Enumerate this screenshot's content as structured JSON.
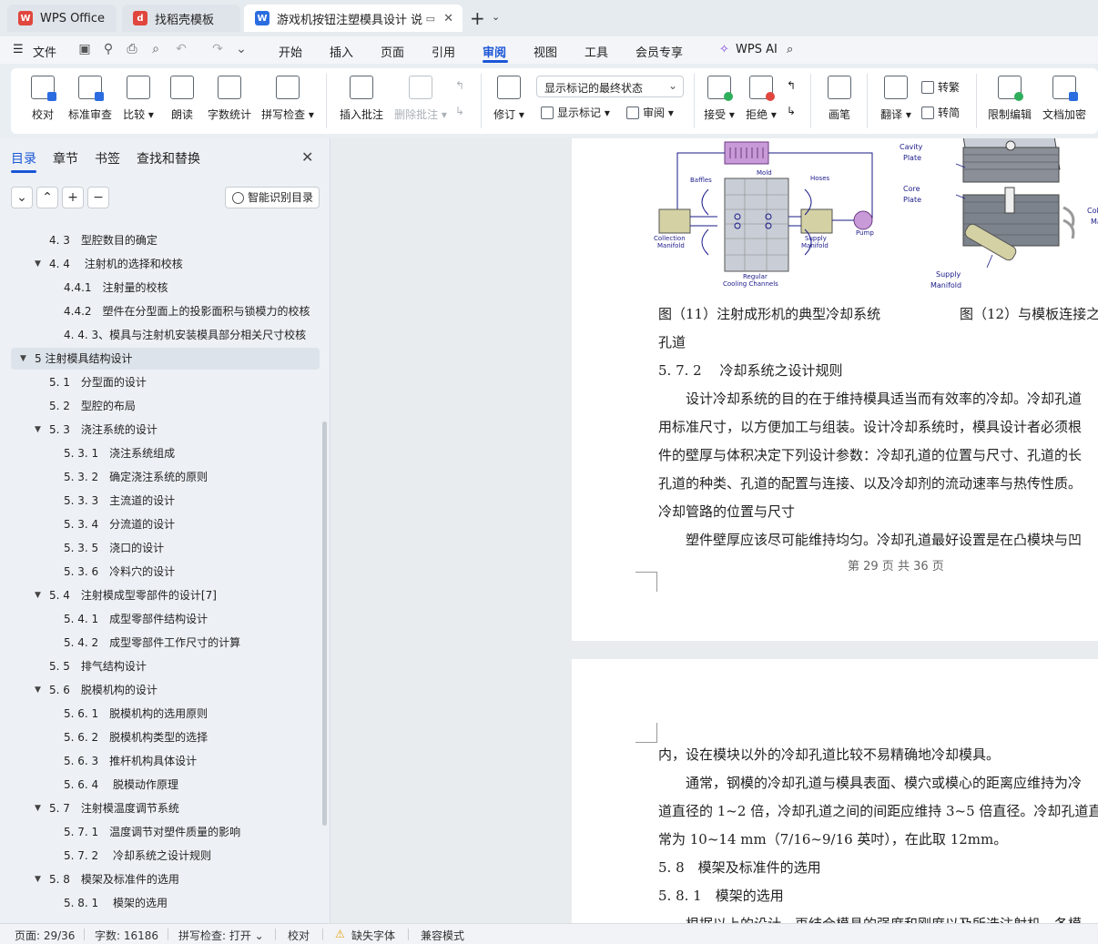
{
  "tabs": [
    {
      "label": "WPS Office",
      "icon": "wps-logo-icon"
    },
    {
      "label": "找稻壳模板",
      "icon": "docer-icon"
    },
    {
      "label": "游戏机按钮注塑模具设计 说明",
      "icon": "writer-doc-icon"
    }
  ],
  "menu": {
    "file": "文件",
    "items": [
      "开始",
      "插入",
      "页面",
      "引用",
      "审阅",
      "视图",
      "工具",
      "会员专享"
    ],
    "active": "审阅",
    "wps_ai": "WPS AI"
  },
  "ribbon": {
    "proofread": "校对",
    "standard_review": "标准审查",
    "compare": "比较",
    "read_aloud": "朗读",
    "word_count": "字数统计",
    "spell_check": "拼写检查",
    "insert_comment": "插入批注",
    "delete_comment": "删除批注",
    "track_changes": "修订",
    "markup_mode": "显示标记的最终状态",
    "show_markup": "显示标记",
    "reviewing": "审阅",
    "accept": "接受",
    "reject": "拒绝",
    "ink": "画笔",
    "translate": "翻译",
    "to_traditional": "转繁",
    "to_simplified": "转简",
    "restrict_editing": "限制编辑",
    "encrypt": "文档加密"
  },
  "sidebar": {
    "tabs": [
      "目录",
      "章节",
      "书签",
      "查找和替换"
    ],
    "smart_toc": "智能识别目录",
    "toc": [
      {
        "text": "4. 3　型腔数目的确定",
        "level": 2
      },
      {
        "text": "4. 4　 注射机的选择和校核",
        "level": 2,
        "expanded": true
      },
      {
        "text": "4.4.1　注射量的校核",
        "level": 3
      },
      {
        "text": "4.4.2　塑件在分型面上的投影面积与锁模力的校核",
        "level": 3
      },
      {
        "text": "4. 4. 3、模具与注射机安装模具部分相关尺寸校核",
        "level": 3
      },
      {
        "text": "5  注射模具结构设计",
        "level": 1,
        "expanded": true,
        "selected": true
      },
      {
        "text": "5. 1　分型面的设计",
        "level": 2
      },
      {
        "text": "5. 2　型腔的布局",
        "level": 2
      },
      {
        "text": "5. 3　浇注系统的设计",
        "level": 2,
        "expanded": true
      },
      {
        "text": "5. 3. 1　浇注系统组成",
        "level": 3
      },
      {
        "text": "5. 3. 2　确定浇注系统的原则",
        "level": 3
      },
      {
        "text": "5. 3. 3　主流道的设计",
        "level": 3
      },
      {
        "text": "5. 3. 4　分流道的设计",
        "level": 3
      },
      {
        "text": "5. 3. 5　浇口的设计",
        "level": 3
      },
      {
        "text": "5. 3. 6　冷料穴的设计",
        "level": 3
      },
      {
        "text": "5. 4　注射模成型零部件的设计[7]",
        "level": 2,
        "expanded": true
      },
      {
        "text": "5. 4. 1　成型零部件结构设计",
        "level": 3
      },
      {
        "text": "5. 4. 2　成型零部件工作尺寸的计算",
        "level": 3
      },
      {
        "text": "5. 5　排气结构设计",
        "level": 2
      },
      {
        "text": "5. 6　脱模机构的设计",
        "level": 2,
        "expanded": true
      },
      {
        "text": "5. 6. 1　脱模机构的选用原则",
        "level": 3
      },
      {
        "text": "5. 6. 2　脱模机构类型的选择",
        "level": 3
      },
      {
        "text": "5. 6. 3　推杆机构具体设计",
        "level": 3
      },
      {
        "text": "5. 6. 4　 脱模动作原理",
        "level": 3
      },
      {
        "text": "5. 7　注射模温度调节系统",
        "level": 2,
        "expanded": true
      },
      {
        "text": "5. 7. 1　温度调节对塑件质量的影响",
        "level": 3
      },
      {
        "text": "5. 7. 2　 冷却系统之设计规则",
        "level": 3
      },
      {
        "text": "5. 8　模架及标准件的选用",
        "level": 2,
        "expanded": true
      },
      {
        "text": "5. 8. 1　 模架的选用",
        "level": 3
      }
    ]
  },
  "document": {
    "figure11_labels": {
      "mold": "Mold",
      "baffles": "Baffles",
      "hoses": "Hoses",
      "collection": "Collection",
      "manifold": "Manifold",
      "supply": "Supply",
      "supply_manifold": "Manifold",
      "pump": "Pump",
      "regular": "Regular",
      "cooling_channels": "Cooling Channels"
    },
    "figure12_labels": {
      "cavity": "Cavity",
      "plate1": "Plate",
      "core": "Core",
      "plate2": "Plate",
      "supply": "Supply",
      "manifold": "Manifold",
      "colle": "Colle",
      "man": "Man"
    },
    "caption11": "图（11）注射成形机的典型冷却系统",
    "caption12": "图（12）与模板连接之",
    "caption_cont": "孔道",
    "heading_572": "5. 7. 2　 冷却系统之设计规则",
    "para1_l1": "　　设计冷却系统的目的在于维持模具适当而有效率的冷却。冷却孔道",
    "para1_l2": "用标准尺寸，以方便加工与组装。设计冷却系统时，模具设计者必须根",
    "para1_l3": "件的壁厚与体积决定下列设计参数：冷却孔道的位置与尺寸、孔道的长",
    "para1_l4": "孔道的种类、孔道的配置与连接、以及冷却剂的流动速率与热传性质。",
    "sub_heading": " 冷却管路的位置与尺寸",
    "para2": "　　塑件壁厚应该尽可能维持均匀。冷却孔道最好设置是在凸模块与凹",
    "page_footer": "第 29 页 共 36 页",
    "p2_l1": "内，设在模块以外的冷却孔道比较不易精确地冷却模具。",
    "p2_l2": "　　通常，钢模的冷却孔道与模具表面、模穴或模心的距离应维持为冷",
    "p2_l3": "道直径的 1~2 倍，冷却孔道之间的间距应维持 3~5 倍直径。冷却孔道直",
    "p2_l4": "常为 10~14 mm（7/16~9/16 英吋），在此取 12mm。",
    "p2_h1": "5. 8　模架及标准件的选用",
    "p2_h2": "5. 8. 1　模架的选用",
    "p2_l5": "　　根据以上的设计，再结合模具的强度和刚度以及所选注射机，各模"
  },
  "status": {
    "page": "页面: 29/36",
    "words": "字数: 16186",
    "spell": "拼写检查: 打开",
    "proof": "校对",
    "missing_font": "缺失字体",
    "compat": "兼容模式"
  },
  "colors": {
    "accent": "#1a56d6",
    "wps_red": "#e0463d",
    "writer_blue": "#2b6de0",
    "warning": "#e8a317"
  }
}
